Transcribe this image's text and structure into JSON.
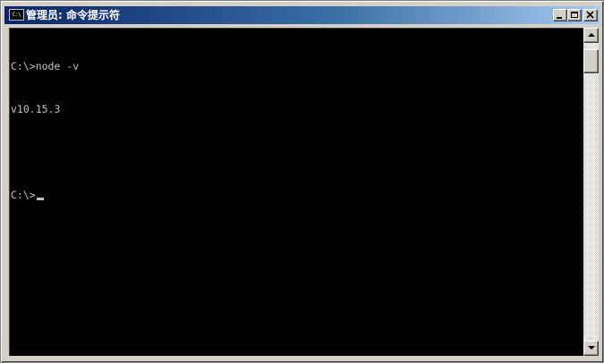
{
  "window": {
    "title": "管理员: 命令提示符",
    "icon_text": "C:\\"
  },
  "titlebar_buttons": {
    "minimize": "minimize-icon",
    "maximize": "maximize-icon",
    "close": "close-icon"
  },
  "console": {
    "lines": [
      "C:\\>node -v",
      "v10.15.3",
      "",
      "C:\\>"
    ],
    "text_color": "#c0c0c0",
    "background": "#000000"
  },
  "colors": {
    "titlebar_start": "#0a246a",
    "titlebar_end": "#a6caf0",
    "chrome": "#d4d0c8"
  }
}
